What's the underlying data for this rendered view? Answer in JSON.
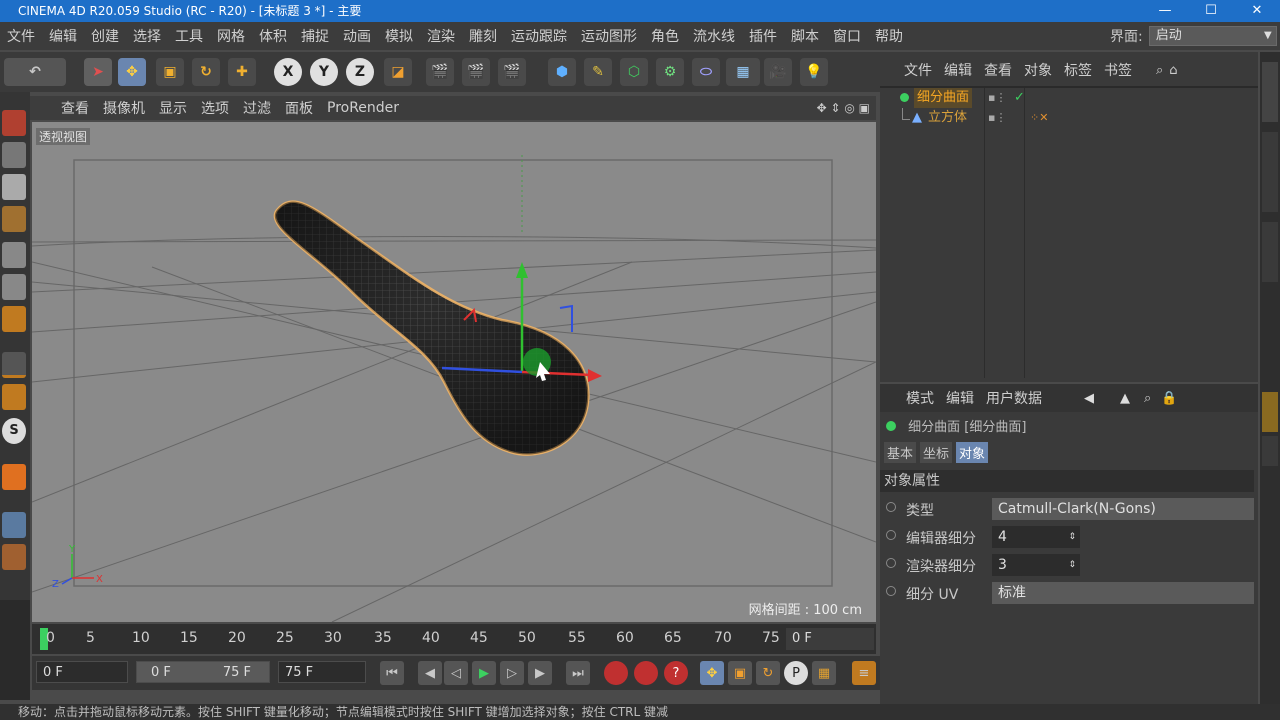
{
  "title_bar": {
    "title": "CINEMA 4D R20.059 Studio (RC - R20) - [未标题 3 *] - 主要"
  },
  "menu": {
    "items": [
      "文件",
      "编辑",
      "创建",
      "选择",
      "工具",
      "网格",
      "体积",
      "捕捉",
      "动画",
      "模拟",
      "渲染",
      "雕刻",
      "运动跟踪",
      "运动图形",
      "角色",
      "流水线",
      "插件",
      "脚本",
      "窗口",
      "帮助"
    ],
    "interface_label": "界面:",
    "interface_value": "启动"
  },
  "viewport": {
    "menu": [
      "查看",
      "摄像机",
      "显示",
      "选项",
      "过滤",
      "面板",
      "ProRender"
    ],
    "label": "透视视图",
    "grid_spacing": "网格间距 : 100 cm"
  },
  "timeline": {
    "ticks": [
      "0",
      "5",
      "10",
      "15",
      "20",
      "25",
      "30",
      "35",
      "40",
      "45",
      "50",
      "55",
      "60",
      "65",
      "70",
      "75"
    ],
    "current_frame": "0 F"
  },
  "controls": {
    "start_frame": "0 F",
    "range_start": "0 F",
    "range_end": "75 F",
    "end_frame": "75 F"
  },
  "object_manager": {
    "menu": [
      "文件",
      "编辑",
      "查看",
      "对象",
      "标签",
      "书签"
    ],
    "objects": [
      {
        "name": "细分曲面",
        "color": "#f5a623"
      },
      {
        "name": "立方体",
        "color": "#d9a13a"
      }
    ]
  },
  "attribute_manager": {
    "menu": [
      "模式",
      "编辑",
      "用户数据"
    ],
    "object_title": "细分曲面 [细分曲面]",
    "tabs": [
      "基本",
      "坐标",
      "对象"
    ],
    "section": "对象属性",
    "props": [
      {
        "label": "类型",
        "value": "Catmull-Clark(N-Gons)"
      },
      {
        "label": "编辑器细分",
        "value": "4"
      },
      {
        "label": "渲染器细分",
        "value": "3"
      },
      {
        "label": "细分 UV",
        "value": "标准"
      }
    ]
  },
  "status": {
    "text": "移动：点击并拖动鼠标移动元素。按住 SHIFT 键量化移动；节点编辑模式时按住 SHIFT 键增加选择对象；按住 CTRL 键减"
  },
  "colors": {
    "accent": "#1e6fc8",
    "viewport_bg": "#8a8a8a",
    "mesh_outline": "#e8b068",
    "axis_x": "#e03030",
    "axis_y": "#30c030",
    "axis_z": "#3050e0"
  }
}
